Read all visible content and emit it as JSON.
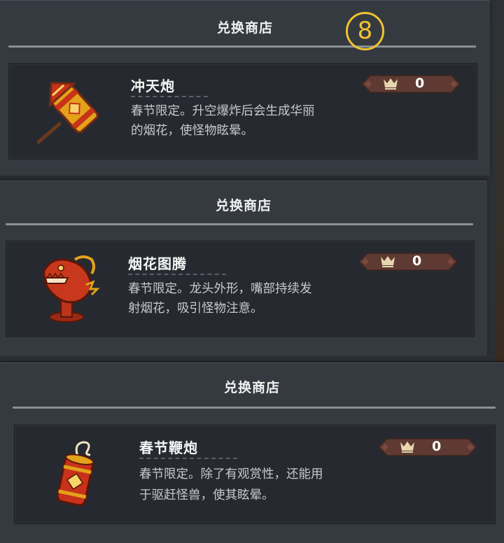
{
  "marker": {
    "label": "8"
  },
  "panels": [
    {
      "title": "兑换商店",
      "item": {
        "name": "冲天炮",
        "desc_line1": "春节限定。升空爆炸后会生成华丽",
        "desc_line2": "的烟花，使怪物眩晕。",
        "price": "0",
        "icon": "rocket-firework-icon"
      }
    },
    {
      "title": "兑换商店",
      "item": {
        "name": "烟花图腾",
        "desc_line1": "春节限定。龙头外形，嘴部持续发",
        "desc_line2": "射烟花，吸引怪物注意。",
        "price": "0",
        "icon": "dragon-totem-icon"
      }
    },
    {
      "title": "兑换商店",
      "item": {
        "name": "春节鞭炮",
        "desc_line1": "春节限定。除了有观赏性，还能用",
        "desc_line2": "于驱赶怪兽，使其眩晕。",
        "price": "0",
        "icon": "firecracker-icon"
      }
    }
  ],
  "currency_icon": "crown-icon",
  "colors": {
    "panel_bg": "#353a41",
    "card_bg": "#262a30",
    "price_tag": "#5e3a32",
    "marker": "#f2c230"
  }
}
